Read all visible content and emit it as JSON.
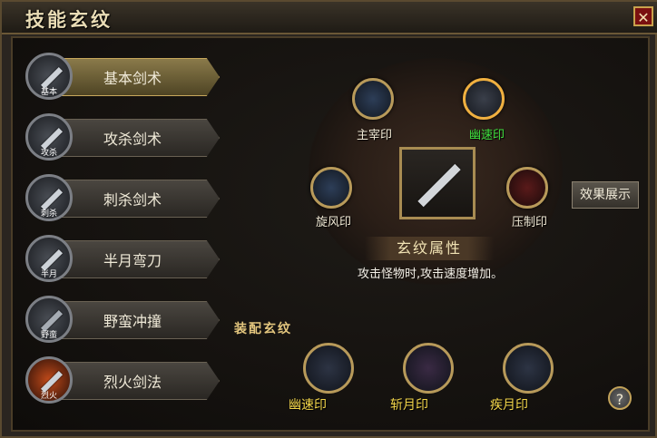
{
  "window": {
    "title": "技能玄纹",
    "close_label": "✕"
  },
  "skills": [
    {
      "label": "基本剑术",
      "sub": "基本",
      "active": true
    },
    {
      "label": "攻杀剑术",
      "sub": "攻杀",
      "active": false
    },
    {
      "label": "刺杀剑术",
      "sub": "刺杀",
      "active": false
    },
    {
      "label": "半月弯刀",
      "sub": "半月",
      "active": false
    },
    {
      "label": "野蛮冲撞",
      "sub": "野蛮",
      "active": false
    },
    {
      "label": "烈火剑法",
      "sub": "烈火",
      "active": false
    }
  ],
  "runes": {
    "top_left": "主宰印",
    "top_right": "幽速印",
    "left": "旋风印",
    "right": "压制印"
  },
  "effect_button": "效果展示",
  "attribute": {
    "title": "玄纹属性",
    "description": "攻击怪物时,攻击速度增加。"
  },
  "equip": {
    "title": "装配玄纹",
    "items": [
      "幽速印",
      "斩月印",
      "疾月印"
    ]
  },
  "help_label": "?",
  "colors": {
    "accent": "#c9a24d",
    "selected_rune_label": "#3fe03f",
    "equip_label": "#f3d64a"
  }
}
